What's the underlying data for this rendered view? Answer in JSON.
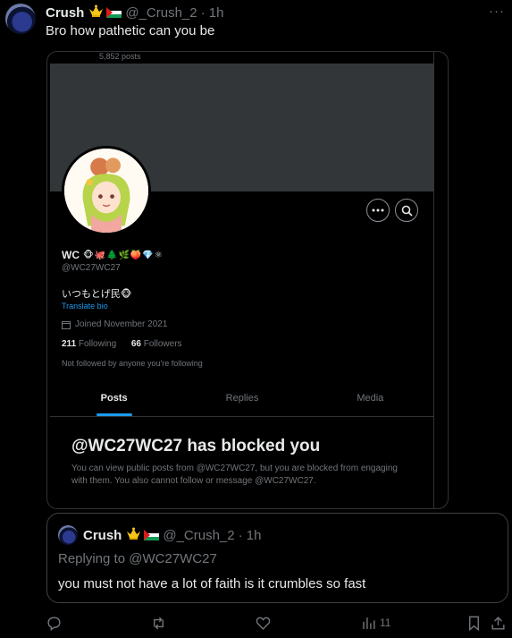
{
  "tweet": {
    "author_name": "Crush",
    "handle": "@_Crush_2",
    "time": "· 1h",
    "text": "Bro how pathetic can you be",
    "more": "···"
  },
  "screenshot": {
    "posts_count": "5,852 posts",
    "profile_name": "WC",
    "profile_emojis": "🐵🐙🌲🌿🍑💎⚛",
    "profile_handle": "@WC27WC27",
    "bio": "いつもとげ民🐵",
    "translate": "Translate bio",
    "joined": "Joined November 2021",
    "following_count": "211",
    "following_label": "Following",
    "followers_count": "66",
    "followers_label": "Followers",
    "not_followed": "Not followed by anyone you're following",
    "tabs": [
      {
        "label": "Posts"
      },
      {
        "label": "Replies"
      },
      {
        "label": "Media"
      }
    ],
    "blocked_title": "@WC27WC27 has blocked you",
    "blocked_desc": "You can view public posts from @WC27WC27, but you are blocked from engaging with them. You also cannot follow or message @WC27WC27."
  },
  "quote": {
    "author_name": "Crush",
    "handle": "@_Crush_2",
    "time": "· 1h",
    "replying_to": "Replying to @WC27WC27",
    "text": "you must not have a lot of faith is it crumbles so fast"
  },
  "actions": {
    "views_count": "11"
  },
  "colors": {
    "accent": "#1d9bf0",
    "muted": "#71767b",
    "text": "#e7e9ea",
    "banner": "#323638"
  }
}
